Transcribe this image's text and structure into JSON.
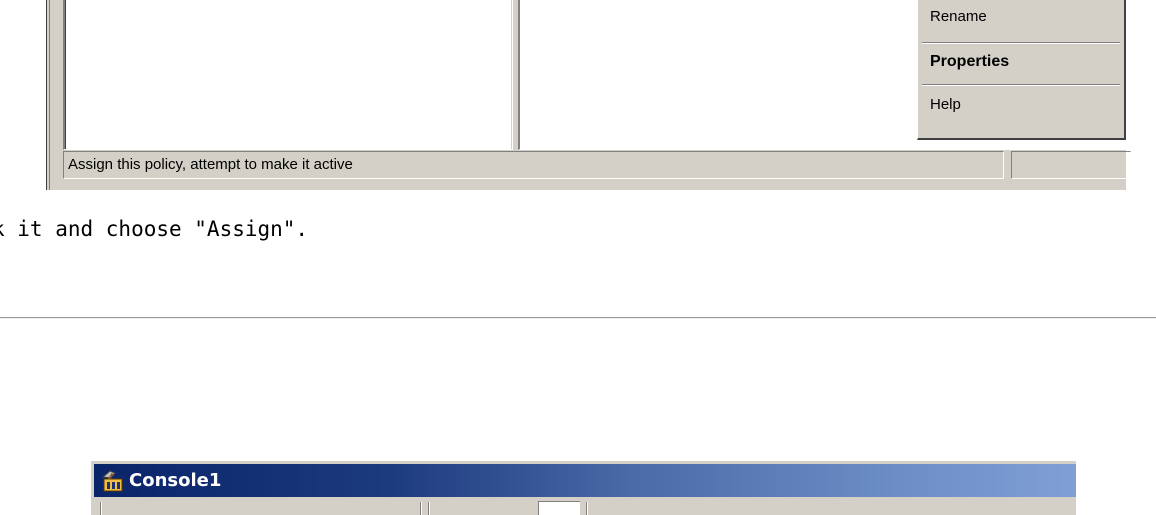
{
  "top_screenshot": {
    "context_menu": {
      "items": [
        {
          "label": "Rename"
        },
        {
          "label": "Properties"
        },
        {
          "label": "Help"
        }
      ]
    },
    "status_bar": {
      "text": "Assign this policy, attempt to make it active",
      "secondary_text": ""
    }
  },
  "instruction": {
    "text": "k it and choose \"Assign\"."
  },
  "bottom_screenshot": {
    "window_title": "Console1",
    "icon": "mmc-console-icon"
  }
}
